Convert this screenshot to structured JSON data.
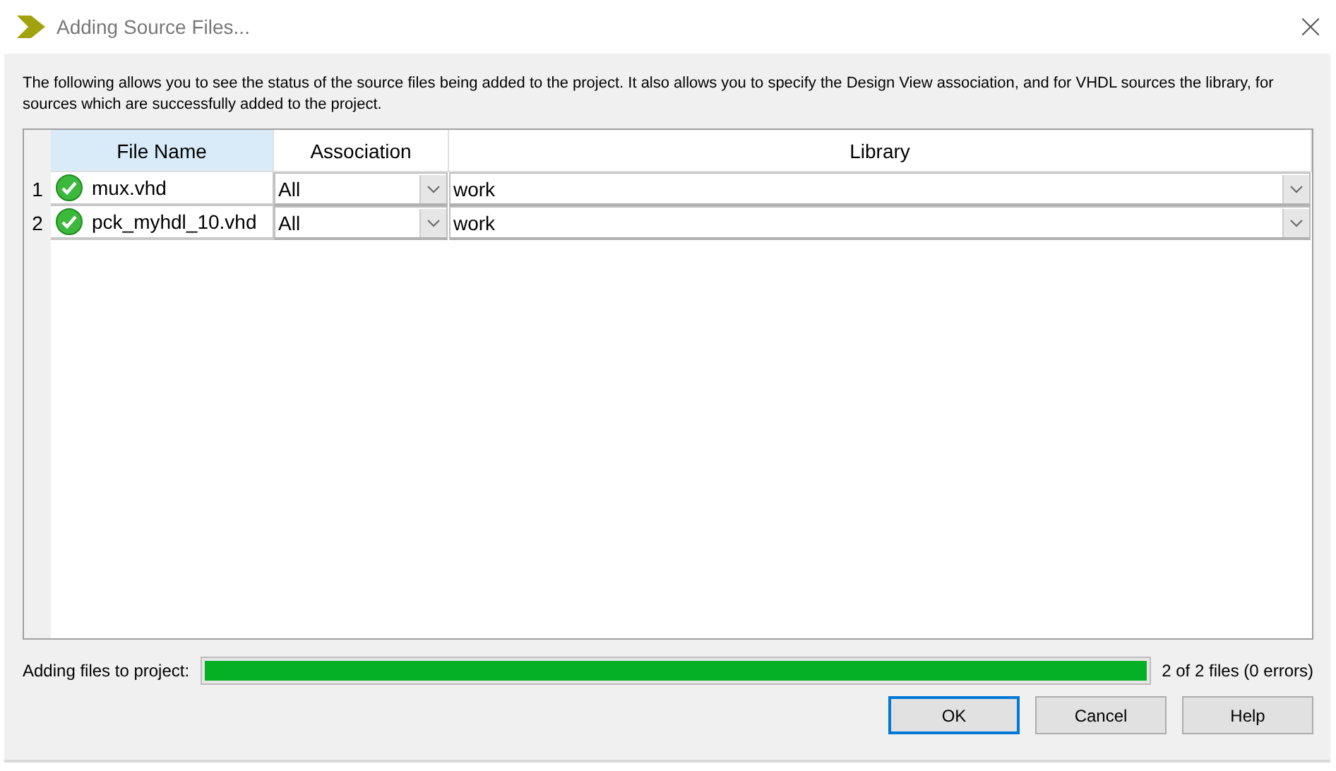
{
  "window": {
    "title": "Adding Source Files..."
  },
  "description": "The following allows you to see the status of the source files being added to the project.  It also allows you to specify the Design View association, and for VHDL sources the library, for sources which are successfully added to the project.",
  "table": {
    "columns": [
      {
        "label": "File Name",
        "selected": true
      },
      {
        "label": "Association",
        "selected": false
      },
      {
        "label": "Library",
        "selected": false
      }
    ],
    "rows": [
      {
        "number": "1",
        "added": true,
        "file_name": "mux.vhd",
        "association": "All",
        "library": "work"
      },
      {
        "number": "2",
        "added": true,
        "file_name": "pck_myhdl_10.vhd",
        "association": "All",
        "library": "work"
      }
    ]
  },
  "progress": {
    "label": "Adding files to project:",
    "level": 1,
    "reading": "2 of 2 files (0 errors)"
  },
  "buttons": [
    {
      "label": "OK",
      "default": true
    },
    {
      "label": "Cancel",
      "default": false
    },
    {
      "label": "Help",
      "default": false
    }
  ]
}
